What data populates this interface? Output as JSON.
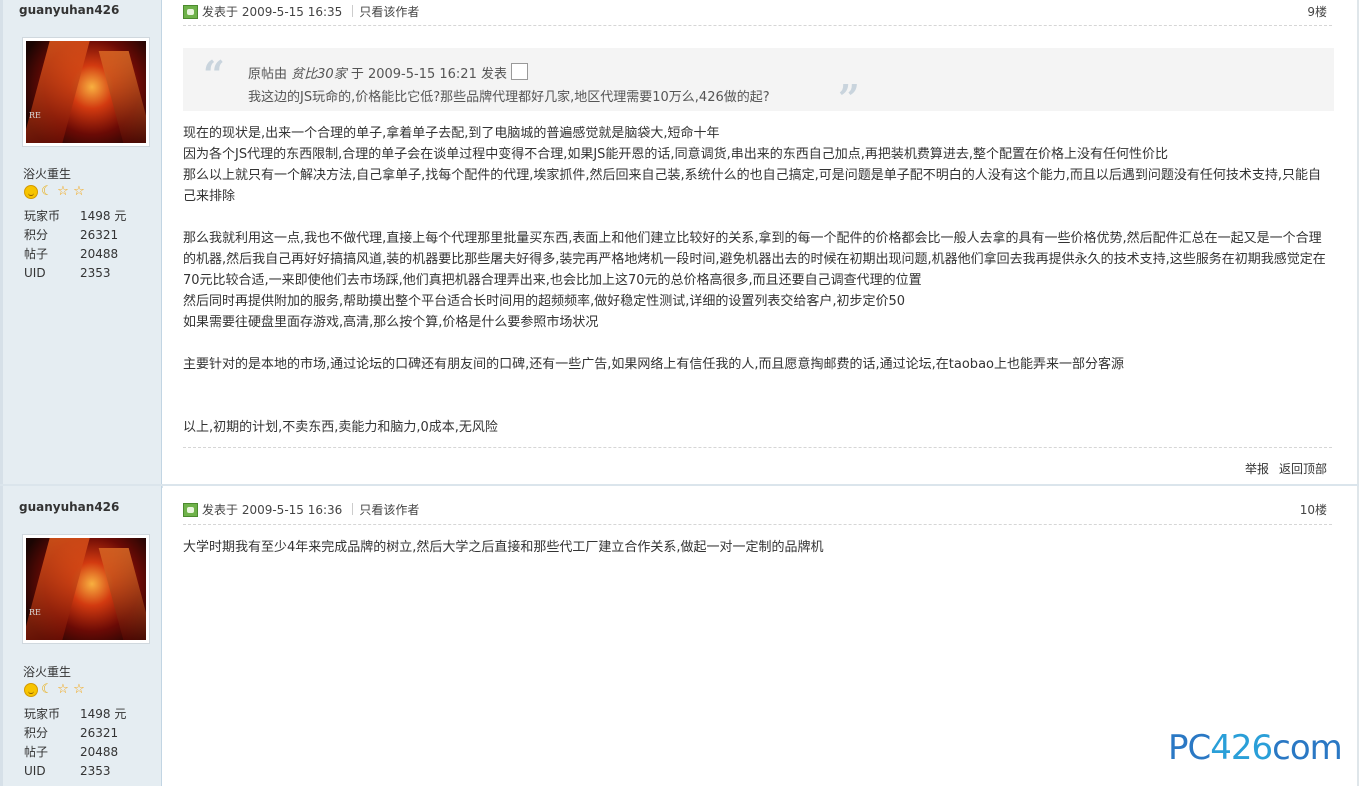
{
  "posts": [
    {
      "username": "guanyuhan426",
      "user_title": "浴火重生",
      "stats": [
        {
          "label": "玩家币",
          "value": "1498 元"
        },
        {
          "label": "积分",
          "value": "26321"
        },
        {
          "label": "帖子",
          "value": "20488"
        },
        {
          "label": "UID",
          "value": "2353"
        }
      ],
      "posted": "发表于 2009-5-15 16:35",
      "author_only": "只看该作者",
      "floor": "9楼",
      "quote": {
        "prefix": "原帖由",
        "author": "贫比30家",
        "middle": "于 2009-5-15 16:21 发表",
        "text": "我这边的JS玩命的,价格能比它低?那些品牌代理都好几家,地区代理需要10万么,426做的起?"
      },
      "body": [
        "现在的现状是,出来一个合理的单子,拿着单子去配,到了电脑城的普遍感觉就是脑袋大,短命十年",
        "因为各个JS代理的东西限制,合理的单子会在谈单过程中变得不合理,如果JS能开恩的话,同意调货,串出来的东西自己加点,再把装机费算进去,整个配置在价格上没有任何性价比",
        "那么以上就只有一个解决方法,自己拿单子,找每个配件的代理,埃家抓件,然后回来自己装,系统什么的也自己搞定,可是问题是单子配不明白的人没有这个能力,而且以后遇到问题没有任何技术支持,只能自己来排除",
        "",
        "那么我就利用这一点,我也不做代理,直接上每个代理那里批量买东西,表面上和他们建立比较好的关系,拿到的每一个配件的价格都会比一般人去拿的具有一些价格优势,然后配件汇总在一起又是一个合理的机器,然后我自己再好好搞搞风道,装的机器要比那些屠夫好得多,装完再严格地烤机一段时间,避免机器出去的时候在初期出现问题,机器他们拿回去我再提供永久的技术支持,这些服务在初期我感觉定在70元比较合适,一来即使他们去市场踩,他们真把机器合理弄出来,也会比加上这70元的总价格高很多,而且还要自己调查代理的位置",
        "然后同时再提供附加的服务,帮助摸出整个平台适合长时间用的超频频率,做好稳定性测试,详细的设置列表交给客户,初步定价50",
        "如果需要往硬盘里面存游戏,高清,那么按个算,价格是什么要参照市场状况",
        "",
        "主要针对的是本地的市场,通过论坛的口碑还有朋友间的口碑,还有一些广告,如果网络上有信任我的人,而且愿意掏邮费的话,通过论坛,在taobao上也能弄来一部分客源",
        "",
        "",
        "以上,初期的计划,不卖东西,卖能力和脑力,0成本,无风险"
      ],
      "report": "举报",
      "top": "返回顶部"
    },
    {
      "username": "guanyuhan426",
      "user_title": "浴火重生",
      "stats": [
        {
          "label": "玩家币",
          "value": "1498 元"
        },
        {
          "label": "积分",
          "value": "26321"
        },
        {
          "label": "帖子",
          "value": "20488"
        },
        {
          "label": "UID",
          "value": "2353"
        }
      ],
      "posted": "发表于 2009-5-15 16:36",
      "author_only": "只看该作者",
      "floor": "10楼",
      "body_text": "大学时期我有至少4年来完成品牌的树立,然后大学之后直接和那些代工厂建立合作关系,做起一对一定制的品牌机"
    }
  ],
  "watermark": {
    "part1": "PC",
    "part2": "426",
    "part3": "com"
  }
}
